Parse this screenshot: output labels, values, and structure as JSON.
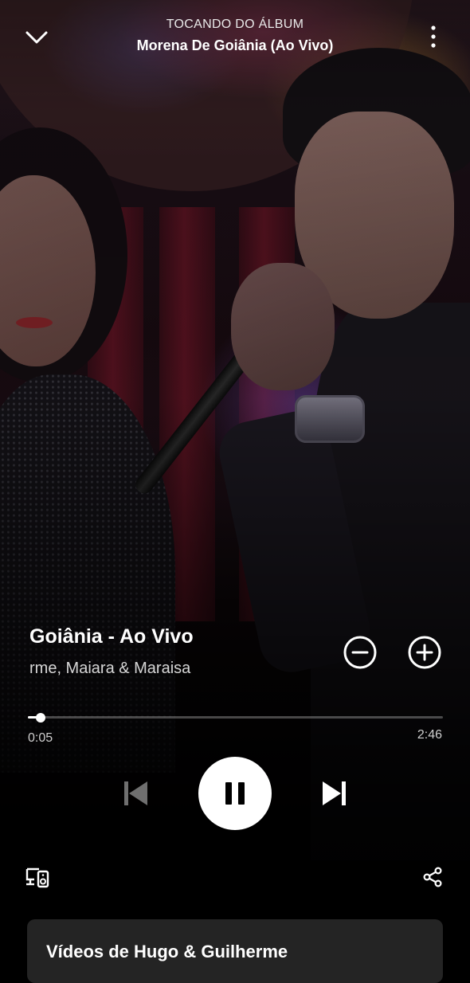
{
  "header": {
    "context_label": "TOCANDO DO ÁLBUM",
    "album_name": "Morena De Goiânia (Ao Vivo)",
    "collapse_icon": "chevron-down-icon",
    "menu_icon": "more-vertical-icon"
  },
  "track": {
    "title": "Goiânia - Ao Vivo",
    "artists": "rme, Maiara & Maraisa"
  },
  "progress": {
    "elapsed": "0:05",
    "total": "2:46",
    "fraction": 0.03
  },
  "controls": {
    "remove_icon": "minus-circle-icon",
    "add_icon": "plus-circle-icon",
    "previous_icon": "skip-previous-icon",
    "pause_icon": "pause-icon",
    "next_icon": "skip-next-icon",
    "devices_icon": "devices-icon",
    "share_icon": "share-icon"
  },
  "video_card": {
    "title": "Vídeos de Hugo & Guilherme"
  },
  "colors": {
    "background": "#000000",
    "text": "#ffffff",
    "secondary_text": "#d6d6d6",
    "card": "#242424",
    "progress_track": "#5a5a5a"
  }
}
